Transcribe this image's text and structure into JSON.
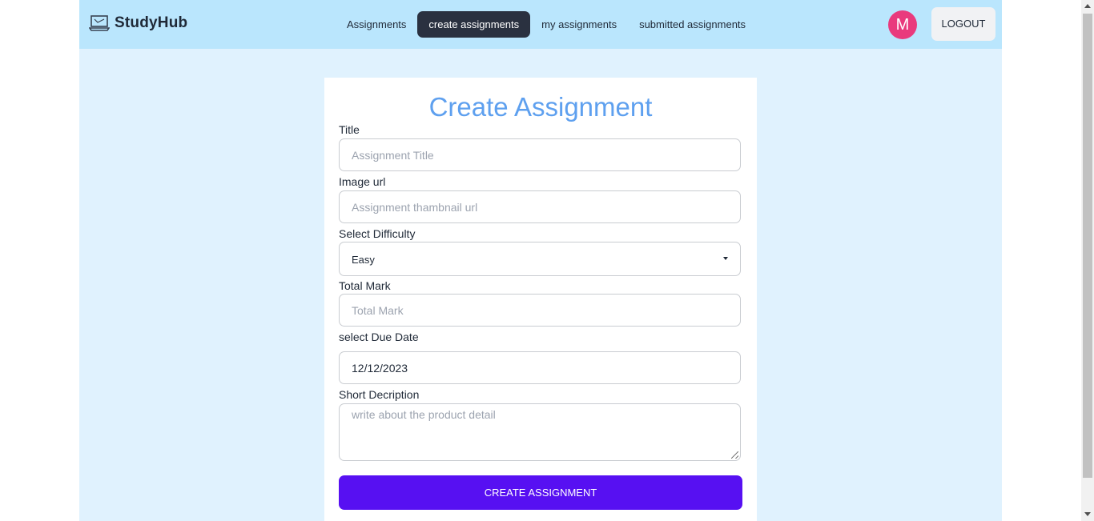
{
  "brand": {
    "name": "StudyHub",
    "icon": "laptop-icon"
  },
  "nav": {
    "items": [
      {
        "label": "Assignments",
        "active": false
      },
      {
        "label": "create assignments",
        "active": true
      },
      {
        "label": "my assignments",
        "active": false
      },
      {
        "label": "submitted assignments",
        "active": false
      }
    ]
  },
  "user": {
    "avatar_letter": "M",
    "avatar_color": "#e93a7d",
    "logout_label": "LOGOUT"
  },
  "form": {
    "heading": "Create Assignment",
    "title": {
      "label": "Title",
      "placeholder": "Assignment Title"
    },
    "image": {
      "label": "Image url",
      "placeholder": "Assignment thambnail url"
    },
    "difficulty": {
      "label": "Select Difficulty",
      "value": "Easy"
    },
    "total_mark": {
      "label": "Total Mark",
      "placeholder": "Total Mark"
    },
    "due_date": {
      "label": "select Due Date",
      "value": "12/12/2023"
    },
    "description": {
      "label": "Short Decription",
      "placeholder": "write about the product detail"
    },
    "submit_label": "CREATE ASSIGNMENT"
  },
  "colors": {
    "navbar": "#bae6fd",
    "page_background": "#e0f2fe",
    "heading": "#5ea0ef",
    "submit_button": "#5710f2",
    "active_nav": "#2a3140"
  }
}
